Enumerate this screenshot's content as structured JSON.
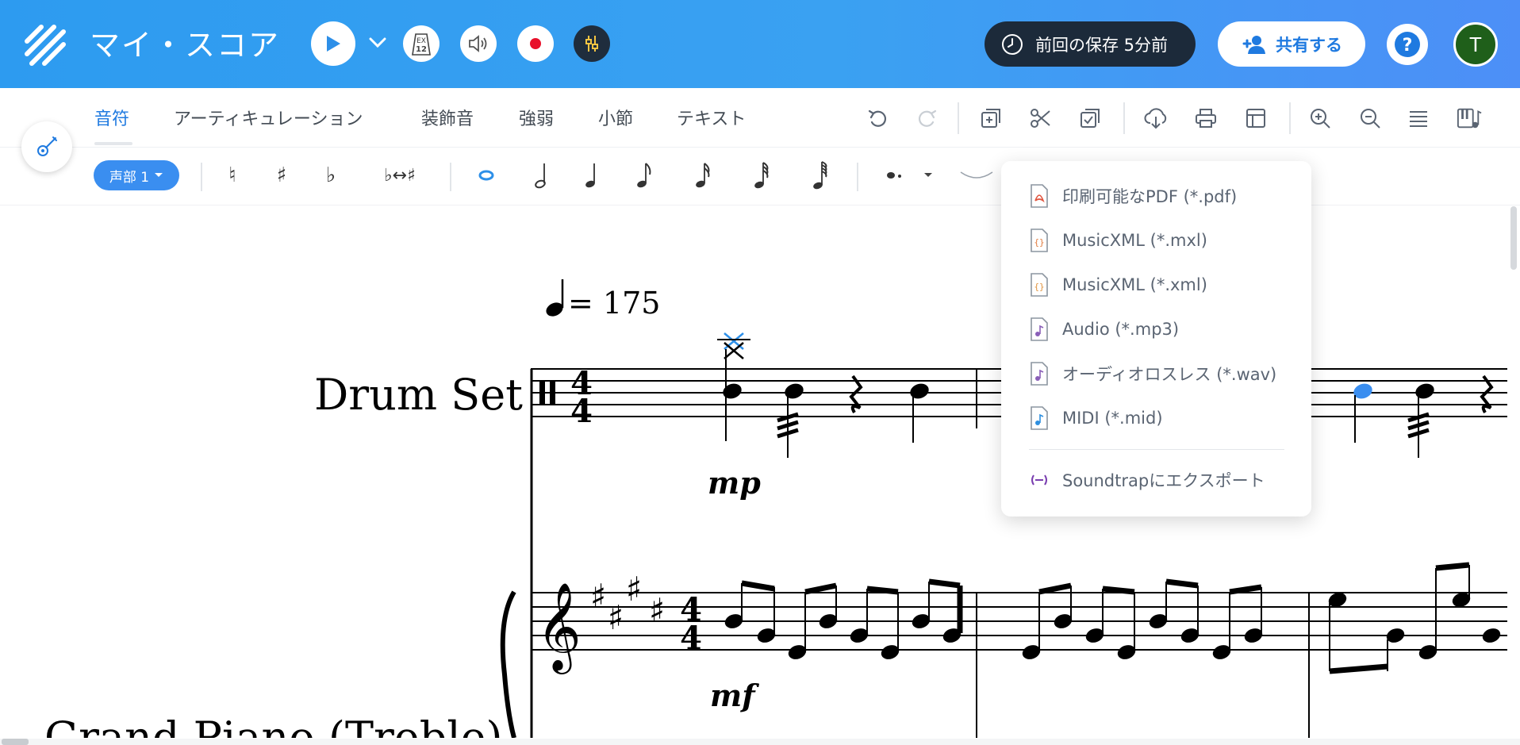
{
  "header": {
    "app_title": "マイ・スコア",
    "tempo_badge_top": "EX",
    "tempo_badge_bottom": "12",
    "save_status": "前回の保存 5分前",
    "share_label": "共有する",
    "help_label": "?",
    "avatar_initial": "T"
  },
  "tabs": [
    {
      "label": "音符",
      "active": true
    },
    {
      "label": "アーティキュレーション",
      "active": false
    },
    {
      "label": "装飾音",
      "active": false
    },
    {
      "label": "強弱",
      "active": false
    },
    {
      "label": "小節",
      "active": false
    },
    {
      "label": "テキスト",
      "active": false
    }
  ],
  "palette": {
    "voice_label": "声部 1",
    "accidentals": [
      "♮",
      "♯",
      "♭",
      "♭↔♯"
    ]
  },
  "score": {
    "tempo_value": "= 175",
    "staff1_name": "Drum Set",
    "dyn_mp": "mp",
    "dyn_mf": "mf",
    "staff2_name": "Grand Piano (Treble)"
  },
  "export_menu": {
    "items": [
      {
        "label": "印刷可能なPDF (*.pdf)",
        "icon": "pdf-file-icon",
        "color": "#e0533d"
      },
      {
        "label": "MusicXML (*.mxl)",
        "icon": "mxl-file-icon",
        "color": "#e07a3d"
      },
      {
        "label": "MusicXML (*.xml)",
        "icon": "xml-file-icon",
        "color": "#e0933d"
      },
      {
        "label": "Audio (*.mp3)",
        "icon": "mp3-file-icon",
        "color": "#8a5fb8"
      },
      {
        "label": "オーディオロスレス (*.wav)",
        "icon": "wav-file-icon",
        "color": "#8a5fb8"
      },
      {
        "label": "MIDI (*.mid)",
        "icon": "midi-file-icon",
        "color": "#2d8fe0"
      }
    ],
    "soundtrap_label": "Soundtrapにエクスポート"
  },
  "colors": {
    "header_gradient_start": "#2d9bf0",
    "accent": "#1f7ae0",
    "selected_note": "#3a8ef0"
  }
}
